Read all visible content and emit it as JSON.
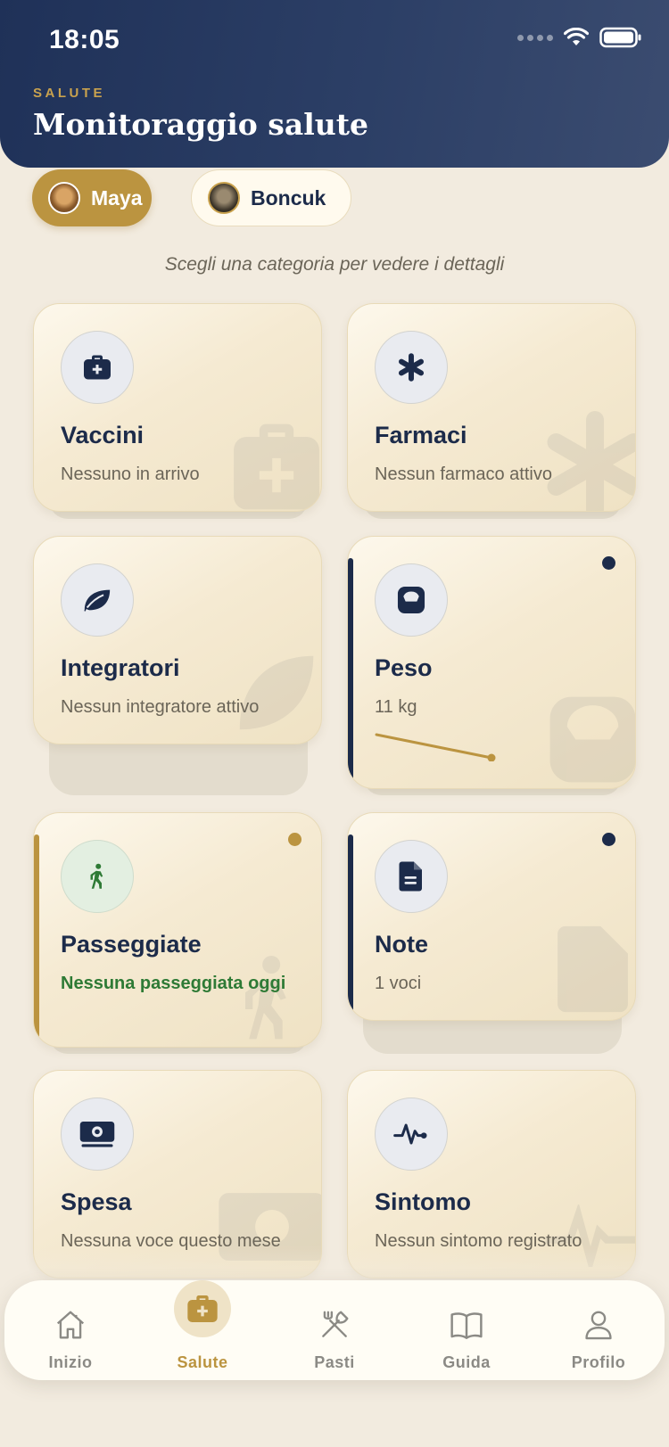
{
  "status_bar": {
    "time": "18:05"
  },
  "header": {
    "eyebrow": "SALUTE",
    "title": "Monitoraggio salute"
  },
  "pets": [
    {
      "name": "Maya",
      "selected": true
    },
    {
      "name": "Boncuk",
      "selected": false
    }
  ],
  "instruction": "Scegli una categoria per vedere i dettagli",
  "cards": {
    "vaccini": {
      "title": "Vaccini",
      "subtitle": "Nessuno in arrivo",
      "icon": "medical-kit-icon"
    },
    "farmaci": {
      "title": "Farmaci",
      "subtitle": "Nessun farmaco attivo",
      "icon": "asterisk-icon"
    },
    "integratori": {
      "title": "Integratori",
      "subtitle": "Nessun integratore attivo",
      "icon": "leaf-icon"
    },
    "peso": {
      "title": "Peso",
      "subtitle": "11 kg",
      "icon": "scale-icon"
    },
    "passeggiate": {
      "title": "Passeggiate",
      "subtitle": "Nessuna passeggiata oggi",
      "icon": "walking-icon"
    },
    "note": {
      "title": "Note",
      "subtitle": "1 voci",
      "icon": "document-icon"
    },
    "spesa": {
      "title": "Spesa",
      "subtitle": "Nessuna voce questo mese",
      "icon": "money-icon"
    },
    "sintomo": {
      "title": "Sintomo",
      "subtitle": "Nessun sintomo registrato",
      "icon": "pulse-icon"
    }
  },
  "tabbar": {
    "items": [
      {
        "label": "Inizio",
        "icon": "home-icon",
        "active": false
      },
      {
        "label": "Salute",
        "icon": "medical-kit-icon",
        "active": true
      },
      {
        "label": "Pasti",
        "icon": "utensils-icon",
        "active": false
      },
      {
        "label": "Guida",
        "icon": "book-icon",
        "active": false
      },
      {
        "label": "Profilo",
        "icon": "user-icon",
        "active": false
      }
    ]
  },
  "colors": {
    "header_navy": "#1f3158",
    "accent_gold": "#bb9440",
    "background": "#f2ebdf",
    "card": "#f5ead2",
    "success_green": "#2e7a35"
  }
}
